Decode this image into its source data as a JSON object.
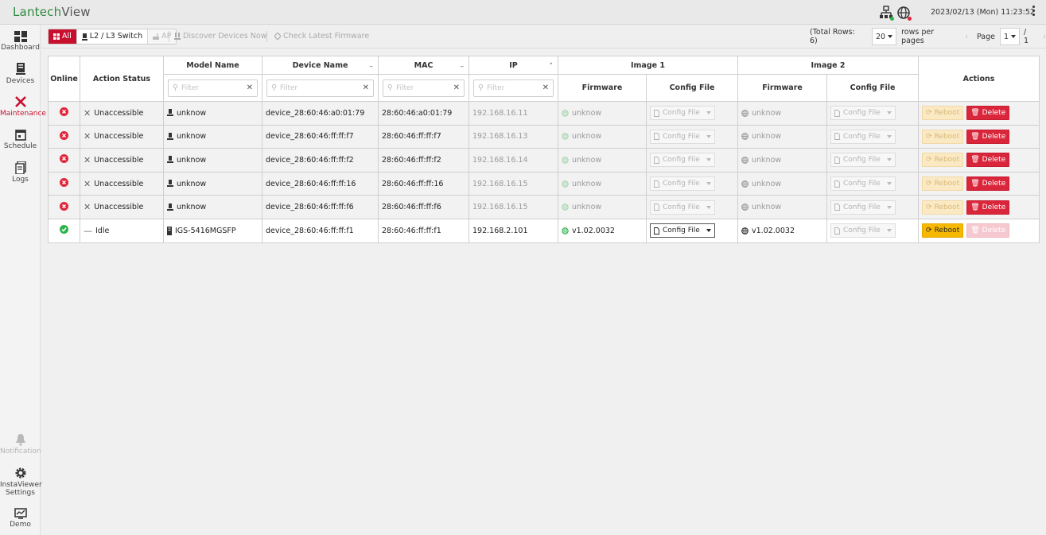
{
  "app": {
    "title_main": "Lantech",
    "title_sub": "View",
    "datetime": "2023/02/13 (Mon) 11:23:52"
  },
  "colors": {
    "accent": "#c8102e",
    "brand_green": "#2e8b3e",
    "online": "#2db34a",
    "offline": "#e0263b",
    "warning": "#f7b900"
  },
  "sidebar": {
    "items": [
      {
        "label": "Dashboard",
        "icon": "dashboard-icon"
      },
      {
        "label": "Devices",
        "icon": "devices-icon"
      },
      {
        "label": "Maintenance",
        "icon": "maintenance-icon",
        "active": true
      },
      {
        "label": "Schedule",
        "icon": "schedule-icon"
      },
      {
        "label": "Logs",
        "icon": "logs-icon"
      }
    ],
    "bottom": [
      {
        "label": "Notification",
        "icon": "bell-icon",
        "disabled": true
      },
      {
        "label": "InstaViewer Settings",
        "icon": "gear-icon"
      },
      {
        "label": "Demo",
        "icon": "demo-icon"
      }
    ]
  },
  "toolbar": {
    "filter_all": "All",
    "filter_switch": "L2 / L3 Switch",
    "filter_ap": "AP",
    "discover": "Discover Devices Now",
    "check_fw": "Check Latest Firmware",
    "total_rows": "(Total Rows: 6)",
    "rows_per_page": "20",
    "rows_label": "rows per pages",
    "page_label": "Page",
    "page": "1",
    "page_total": "/ 1"
  },
  "table": {
    "headers": {
      "online": "Online",
      "action_status": "Action Status",
      "model_name": "Model Name",
      "device_name": "Device Name",
      "mac": "MAC",
      "ip": "IP",
      "image1": "Image 1",
      "image2": "Image 2",
      "firmware": "Firmware",
      "config_file": "Config File",
      "actions": "Actions"
    },
    "filter_placeholder": "Filter",
    "config_label": "Config File",
    "reboot_label": "Reboot",
    "delete_label": "Delete",
    "rows": [
      {
        "online": false,
        "status": "Unaccessible",
        "model": "unknow",
        "device": "device_28:60:46:a0:01:79",
        "mac": "28:60:46:a0:01:79",
        "ip": "192.168.16.11",
        "fw1": "unknow",
        "fw2": "unknow"
      },
      {
        "online": false,
        "status": "Unaccessible",
        "model": "unknow",
        "device": "device_28:60:46:ff:ff:f7",
        "mac": "28:60:46:ff:ff:f7",
        "ip": "192.168.16.13",
        "fw1": "unknow",
        "fw2": "unknow"
      },
      {
        "online": false,
        "status": "Unaccessible",
        "model": "unknow",
        "device": "device_28:60:46:ff:ff:f2",
        "mac": "28:60:46:ff:ff:f2",
        "ip": "192.168.16.14",
        "fw1": "unknow",
        "fw2": "unknow"
      },
      {
        "online": false,
        "status": "Unaccessible",
        "model": "unknow",
        "device": "device_28:60:46:ff:ff:16",
        "mac": "28:60:46:ff:ff:16",
        "ip": "192.168.16.15",
        "fw1": "unknow",
        "fw2": "unknow"
      },
      {
        "online": false,
        "status": "Unaccessible",
        "model": "unknow",
        "device": "device_28:60:46:ff:ff:f6",
        "mac": "28:60:46:ff:ff:f6",
        "ip": "192.168.16.15",
        "fw1": "unknow",
        "fw2": "unknow"
      },
      {
        "online": true,
        "status": "Idle",
        "model": "IGS-5416MGSFP",
        "device": "device_28:60:46:ff:ff:f1",
        "mac": "28:60:46:ff:ff:f1",
        "ip": "192.168.2.101",
        "fw1": "v1.02.0032",
        "fw2": "v1.02.0032"
      }
    ]
  }
}
